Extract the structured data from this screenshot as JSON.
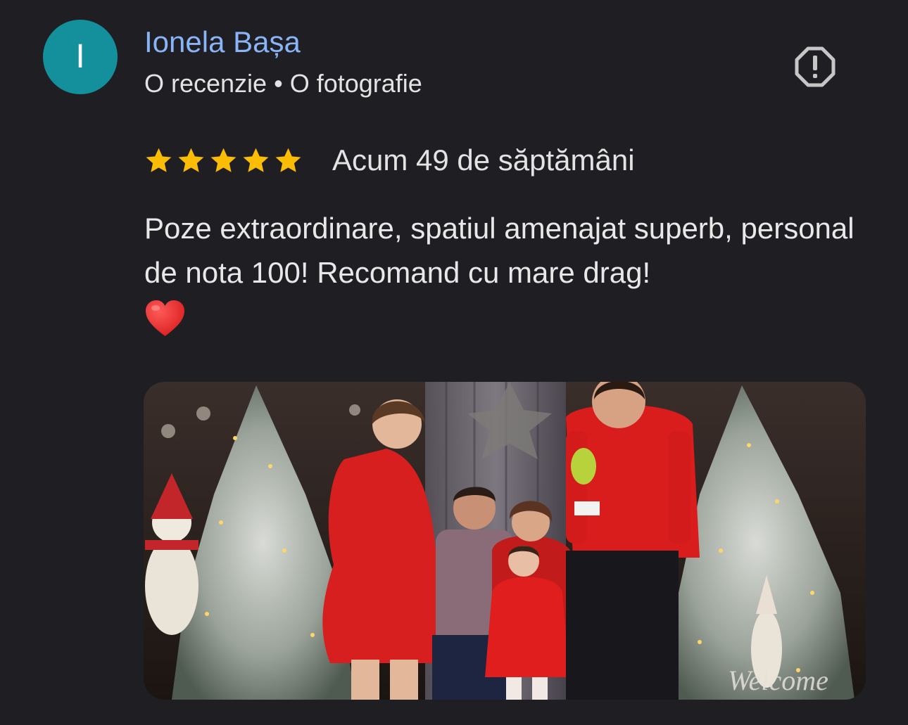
{
  "author": {
    "initial": "I",
    "name": "Ionela Bașa",
    "review_count": "O recenzie",
    "separator": "•",
    "photo_count": "O fotografie",
    "avatar_color": "#13909c",
    "name_color": "#8ab4f8"
  },
  "rating": {
    "stars": 5,
    "star_color": "#fbbc04",
    "timestamp": "Acum 49 de săptămâni"
  },
  "review": {
    "text": "Poze extraordinare, spatiul amenajat superb, personal de nota 100! Recomand cu mare drag!",
    "emoji": "red-heart"
  },
  "icons": {
    "report": "report-icon",
    "star": "star-icon",
    "heart": "heart-icon"
  },
  "photo": {
    "watermark": "Welcome"
  },
  "theme": {
    "background": "#1f1f23",
    "text": "#e3e3e3"
  }
}
